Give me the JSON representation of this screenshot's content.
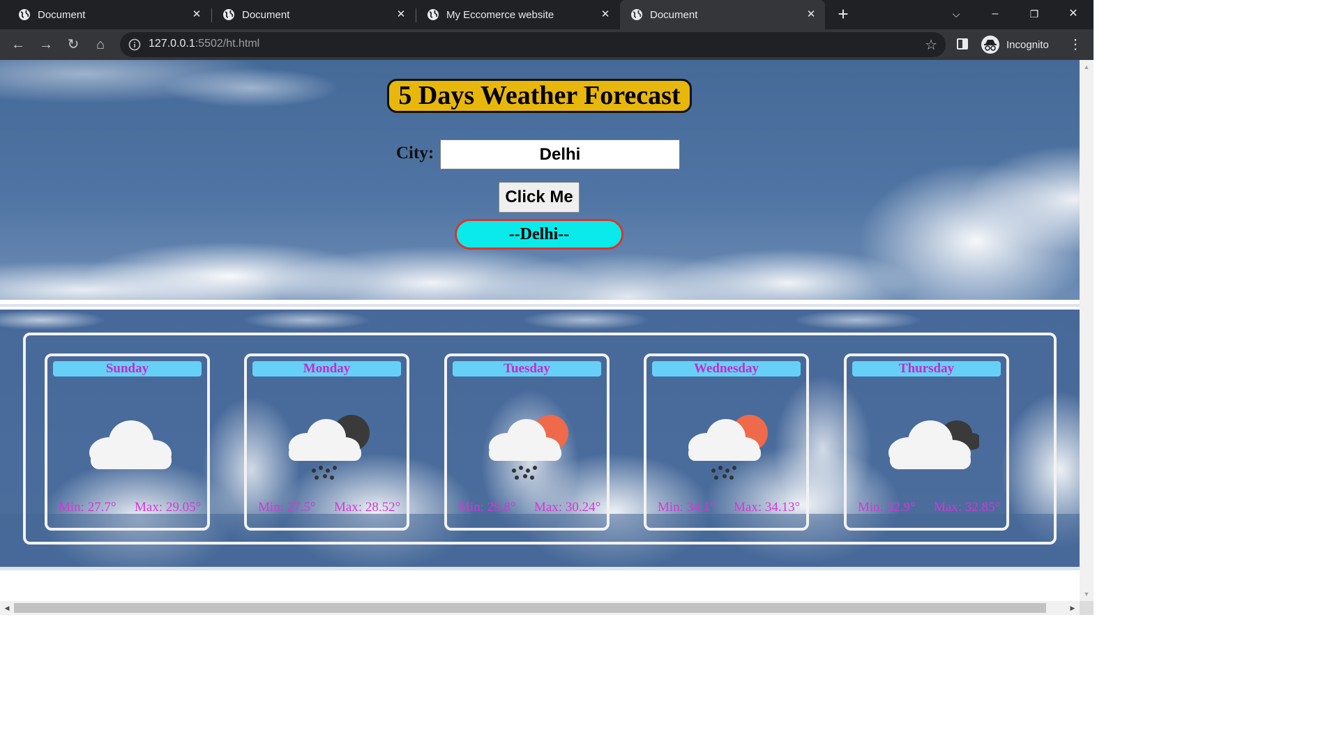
{
  "browser": {
    "tabs": [
      {
        "title": "Document",
        "active": false
      },
      {
        "title": "Document",
        "active": false
      },
      {
        "title": "My Eccomerce website",
        "active": false
      },
      {
        "title": "Document",
        "active": true
      }
    ],
    "url_host": "127.0.0.1",
    "url_path": ":5502/ht.html",
    "profile_label": "Incognito"
  },
  "page": {
    "title": "5 Days Weather Forecast",
    "city_label": "City:",
    "city_value": "Delhi",
    "button_label": "Click Me",
    "city_display": "--Delhi--"
  },
  "forecast": [
    {
      "day": "Sunday",
      "min": "Min: 27.7°",
      "max": "Max: 29.05°",
      "icon": "cloud-icon"
    },
    {
      "day": "Monday",
      "min": "Min: 27.5°",
      "max": "Max: 28.52°",
      "icon": "night-rain-icon"
    },
    {
      "day": "Tuesday",
      "min": "Min: 29.8°",
      "max": "Max: 30.24°",
      "icon": "sun-rain-icon"
    },
    {
      "day": "Wednesday",
      "min": "Min: 34.1°",
      "max": "Max: 34.13°",
      "icon": "sun-rain-icon"
    },
    {
      "day": "Thursday",
      "min": "Min: 32.9°",
      "max": "Max: 32.85°",
      "icon": "cloudy-dark-icon"
    }
  ],
  "colors": {
    "title_bg": "#e8b70c",
    "pill_bg": "#0beaea",
    "pill_border": "#d9362e",
    "day_label_bg": "#67d0f7",
    "day_label_text": "#c829c8",
    "temp_text": "#d636d6"
  }
}
